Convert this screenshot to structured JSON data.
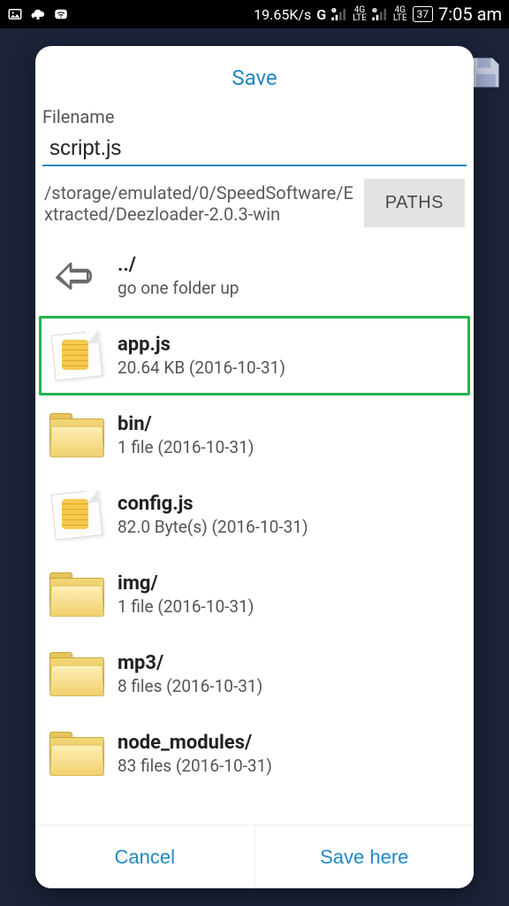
{
  "status_bar": {
    "net_speed": "19.65K/s",
    "carrier": "G",
    "sim1_top": "4G",
    "sim1_bot": "LTE",
    "battery": "37",
    "time": "7:05 am"
  },
  "dialog": {
    "title": "Save",
    "filename_label": "Filename",
    "filename_value": "script.js",
    "current_path": "/storage/emulated/0/SpeedSoftware/Extracted/Deezloader-2.0.3-win",
    "paths_button": "PATHS",
    "cancel": "Cancel",
    "save_here": "Save here"
  },
  "up_row": {
    "title": "../",
    "sub": "go one folder up"
  },
  "entries": [
    {
      "name": "app.js",
      "sub": "20.64 KB (2016-10-31)",
      "type": "file",
      "selected": true
    },
    {
      "name": "bin/",
      "sub": "1 file (2016-10-31)",
      "type": "folder",
      "selected": false
    },
    {
      "name": "config.js",
      "sub": "82.0 Byte(s) (2016-10-31)",
      "type": "file",
      "selected": false
    },
    {
      "name": "img/",
      "sub": "1 file (2016-10-31)",
      "type": "folder",
      "selected": false
    },
    {
      "name": "mp3/",
      "sub": "8 files (2016-10-31)",
      "type": "folder",
      "selected": false
    },
    {
      "name": "node_modules/",
      "sub": "83 files (2016-10-31)",
      "type": "folder",
      "selected": false
    }
  ]
}
